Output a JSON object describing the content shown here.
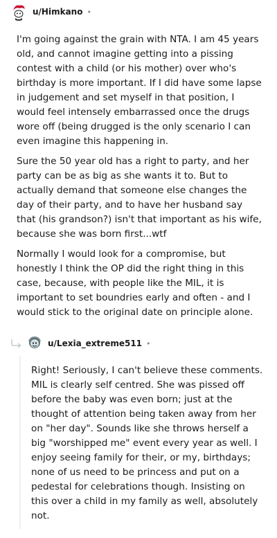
{
  "comments": [
    {
      "username": "u/Himkano",
      "separator": "•",
      "avatar_icon": "reddit-avatar-icon",
      "paragraphs": [
        "I'm going against the grain with NTA. I am 45 years old, and cannot imagine getting into a pissing contest with a child (or his mother) over who's birthday is more important. If I did have some lapse in judgement and set myself in that position, I would feel intensely embarrassed once the drugs wore off (being drugged is the only scenario I can even imagine this happening in.",
        "Sure the 50 year old has a right to party, and her party can be as big as she wants it to. But to actually demand that someone else changes the day of their party, and to have her husband say that (his grandson?) isn't that important as his wife, because she was born first...wtf",
        "Normally I would look for a compromise, but honestly I think the OP did the right thing in this case, because, with people like the MIL, it is important to set boundries early and often - and I would stick to the original date on principle alone."
      ]
    },
    {
      "username": "u/Lexia_extreme511",
      "separator": "•",
      "avatar_icon": "reddit-avatar-icon",
      "reply_icon": "reply-arrow-icon",
      "paragraphs": [
        "Right! Seriously, I can't believe these comments. MIL is clearly self centred. She was pissed off before the baby was even born; just at the thought of attention being taken away from her on \"her day\". Sounds like she throws herself a big \"worshipped me\" event every year as well. I enjoy seeing family for their, or my, birthdays; none of us need to be princess and put on a pedestal for celebrations though. Insisting on this over a child in my family as well, absolutely not."
      ]
    }
  ]
}
